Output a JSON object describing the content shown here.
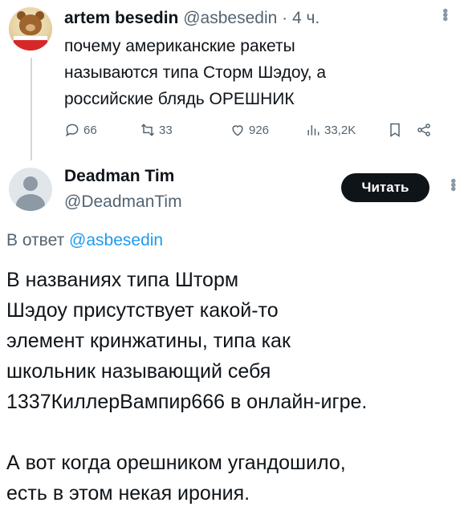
{
  "tweet1": {
    "author_name": "artem besedin",
    "handle": "@asbesedin",
    "time": "· 4 ч.",
    "text_lines": [
      "почему американские ракеты",
      "называются типа Сторм Шэдоу, а",
      "российские блядь ОРЕШНИК"
    ],
    "replies": "66",
    "reposts": "33",
    "likes": "926",
    "views": "33,2K"
  },
  "tweet2": {
    "author_name": "Deadman Tim",
    "handle": "@DeadmanTim",
    "follow_label": "Читать",
    "reply_to_prefix": "В ответ ",
    "reply_to_handle": "@asbesedin",
    "paragraph1_lines": [
      "В названиях типа Шторм",
      "Шэдоу присутствует какой-то",
      "элемент кринжатины, типа как",
      "школьник называющий себя",
      "1337КиллерВампир666 в онлайн-игре."
    ],
    "paragraph2_lines": [
      "А вот когда орешником угандошило,",
      "есть в этом некая ирония."
    ]
  },
  "colors": {
    "text": "#0f1419",
    "secondary": "#536471",
    "link": "#1d9bf0",
    "button_bg": "#0f1419"
  },
  "icons": [
    "reply-icon",
    "repost-icon",
    "like-icon",
    "views-icon",
    "bookmark-icon",
    "share-icon",
    "more-icon"
  ]
}
